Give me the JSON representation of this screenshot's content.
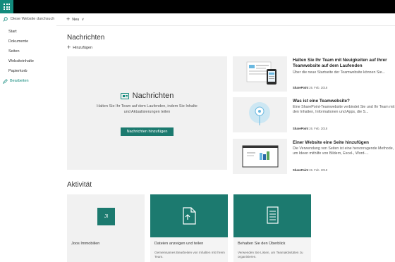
{
  "suite": {
    "app_icon": "waffle-icon"
  },
  "search": {
    "placeholder": "Diese Website durchsuch"
  },
  "nav": {
    "items": [
      "Start",
      "Dokumente",
      "Seiten",
      "Websiteinhalte",
      "Papierkorb"
    ],
    "edit": "Bearbeiten"
  },
  "command_bar": {
    "new_label": "Neu",
    "new_chevron": "∨"
  },
  "news": {
    "title": "Nachrichten",
    "add_label": "Hinzufügen",
    "hero": {
      "heading": "Nachrichten",
      "description": "Halten Sie Ihr Team auf dem Laufenden, indem Sie Inhalte und Aktualisierungen teilen",
      "button": "Nachrichten hinzufügen"
    },
    "cards": [
      {
        "title": "Halten Sie Ihr Team mit Neuigkeiten auf Ihrer Teamwebsite auf dem Laufenden",
        "desc": "Über die neue Startseite der Teamwebsite können Sie...",
        "author": "SharePoint",
        "date": "26. Feb. 2018"
      },
      {
        "title": "Was ist eine Teamwebsite?",
        "desc": "Eine SharePoint-Teamwebsite verbindet Sie und Ihr Team mit den Inhalten, Informationen und Apps, die S...",
        "author": "SharePoint",
        "date": "26. Feb. 2018"
      },
      {
        "title": "Einer Website eine Seite hinzufügen",
        "desc": "Die Verwendung von Seiten ist eine hervorragende Methode, um Ideen mithilfe von Bildern, Excel-, Word-...",
        "author": "SharePoint",
        "date": "26. Feb. 2018"
      }
    ]
  },
  "activity": {
    "title": "Aktivität",
    "cards": [
      {
        "initials": "JI",
        "label": "Joos Immobilien",
        "sub": ""
      },
      {
        "label": "Dateien anzeigen und teilen",
        "sub": "Gemeinsames Bearbeiten von Inhalten mit Ihrem Team."
      },
      {
        "label": "Behalten Sie den Überblick",
        "sub": "Verwenden Sie Listen, um Teamaktivitäten zu organisieren."
      }
    ]
  },
  "colors": {
    "accent": "#1c7a6f",
    "suite_bar": "#000000",
    "tile_bg": "#f1f1f1"
  }
}
